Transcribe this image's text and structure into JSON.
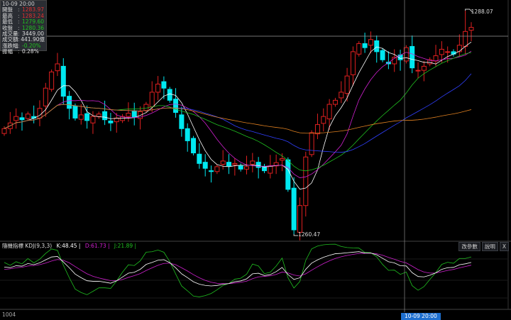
{
  "info_panel": {
    "time": "10-09 20:00",
    "rows": [
      {
        "label": "開盤",
        "value": "1283.97",
        "color": "#e03030"
      },
      {
        "label": "最高",
        "value": "1283.24",
        "color": "#e03030"
      },
      {
        "label": "最低",
        "value": "1279.60",
        "color": "#20c020"
      },
      {
        "label": "收盤",
        "value": "1280.36",
        "color": "#20c020"
      },
      {
        "label": "成交量",
        "value": "3449.00",
        "color": "#dddddd"
      },
      {
        "label": "成交額",
        "value": "441.90億",
        "color": "#dddddd"
      },
      {
        "label": "漲跌幅",
        "value": "-0.20%",
        "color": "#20c020"
      },
      {
        "label": "振幅",
        "value": "0.28%",
        "color": "#dddddd"
      }
    ]
  },
  "indicator": {
    "name": "隨機指標 KDJ(9,3,3)",
    "k": "K:48.45 |",
    "d": "D:61.73 |",
    "j": "J:21.89 |",
    "buttons": [
      "改參數",
      "說明",
      "X"
    ]
  },
  "axis_label": "1004",
  "crosshair_time": "10-09 20:00",
  "price_labels": {
    "high": "1288.07",
    "low": "1260.47"
  },
  "colors": {
    "up": "#e02020",
    "down": "#00e8f0",
    "ma5": "#ffffff",
    "ma10": "#d020d0",
    "ma20": "#20c020",
    "ma30": "#3040ff",
    "ma60": "#e08020",
    "k": "#ffffff",
    "d": "#d020d0",
    "j": "#20c020"
  },
  "chart_data": {
    "type": "candlestick",
    "price_range": [
      1260.47,
      1288.07
    ],
    "closes": [
      1273.5,
      1274.2,
      1275,
      1274.6,
      1275.3,
      1274.8,
      1276,
      1278.5,
      1280.5,
      1281.5,
      1277.5,
      1276,
      1274.8,
      1275.2,
      1274.5,
      1275,
      1275.3,
      1274.6,
      1274.2,
      1274.8,
      1275,
      1275.4,
      1274.9,
      1275.6,
      1276.5,
      1278,
      1279,
      1278.5,
      1277,
      1275.5,
      1273.5,
      1272,
      1270.5,
      1269.2,
      1268.6,
      1268.2,
      1268.8,
      1269.5,
      1268.9,
      1269.2,
      1268.5,
      1268.8,
      1269.5,
      1268.7,
      1268.3,
      1268.9,
      1269.3,
      1269.8,
      1266,
      1261,
      1264,
      1270,
      1273,
      1274,
      1275,
      1276.5,
      1277,
      1278,
      1280,
      1283,
      1284,
      1283.5,
      1284.5,
      1283,
      1282,
      1281.5,
      1282.3,
      1282,
      1283.5,
      1281,
      1280.7,
      1281.2,
      1282,
      1282.5,
      1283.3,
      1283,
      1282.7,
      1283.8,
      1285.5,
      1286
    ]
  }
}
